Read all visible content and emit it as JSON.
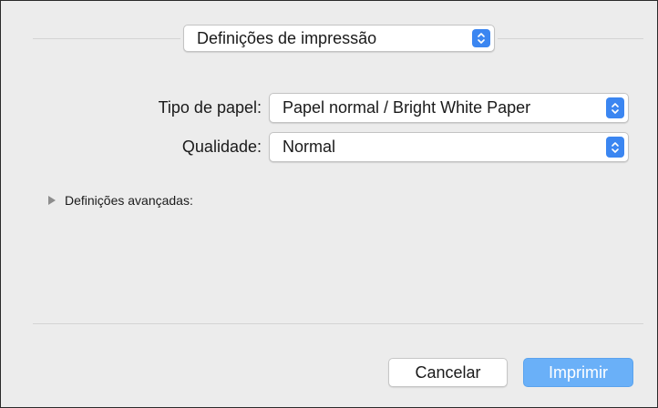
{
  "panel_selector": {
    "value": "Definições de impressão"
  },
  "paper_type": {
    "label": "Tipo de papel:",
    "value": "Papel normal / Bright White Paper"
  },
  "quality": {
    "label": "Qualidade:",
    "value": "Normal"
  },
  "advanced": {
    "label": "Definições avançadas:"
  },
  "buttons": {
    "cancel": "Cancelar",
    "print": "Imprimir"
  },
  "colors": {
    "accent": "#3b86f1",
    "default_button": "#6ab0f8",
    "background": "#ececec"
  },
  "icons": {
    "popup_arrows": "up-down-chevron-icon",
    "disclosure": "disclosure-triangle-icon"
  }
}
